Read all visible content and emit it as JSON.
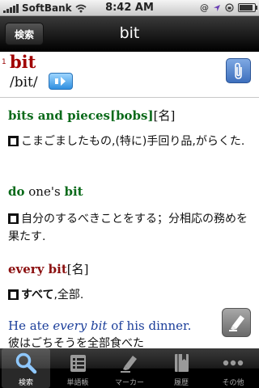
{
  "status_bar": {
    "carrier": "SoftBank",
    "time": "8:42 AM",
    "extra_indicator": "@"
  },
  "nav": {
    "back_label": "検索",
    "title": "bit"
  },
  "entry": {
    "number": "1",
    "headword": "bit",
    "pronunciation": "/bit/"
  },
  "senses": {
    "s1_phrase": "bits and pieces[bobs]",
    "s1_pos": "[名]",
    "s1_def": "こまごましたもの,(特に)手回り品,がらくた.",
    "s2_do": "do",
    "s2_ones": "one's",
    "s2_bit": "bit",
    "s2_def": "自分のするべきことをする；分相応の務めを果たす.",
    "s3_phrase": "every bit",
    "s3_pos": "[名]",
    "s3_def_bold": "すべて",
    "s3_def_rest": ",全部.",
    "ex_pre": "He ate ",
    "ex_em": "every bit",
    "ex_post": " of his dinner.",
    "ex_trans": "彼はごちそうを全部食べた"
  },
  "tabs": [
    {
      "label": "検索",
      "icon": "search-icon"
    },
    {
      "label": "単語帳",
      "icon": "wordbook-icon"
    },
    {
      "label": "マーカー",
      "icon": "marker-icon"
    },
    {
      "label": "履歴",
      "icon": "history-icon"
    },
    {
      "label": "その他",
      "icon": "more-icon"
    }
  ],
  "colors": {
    "headword": "#a00000",
    "phrase_green": "#0a6a1a",
    "phrase_red": "#8b1010",
    "example_blue": "#1b3e9a"
  }
}
